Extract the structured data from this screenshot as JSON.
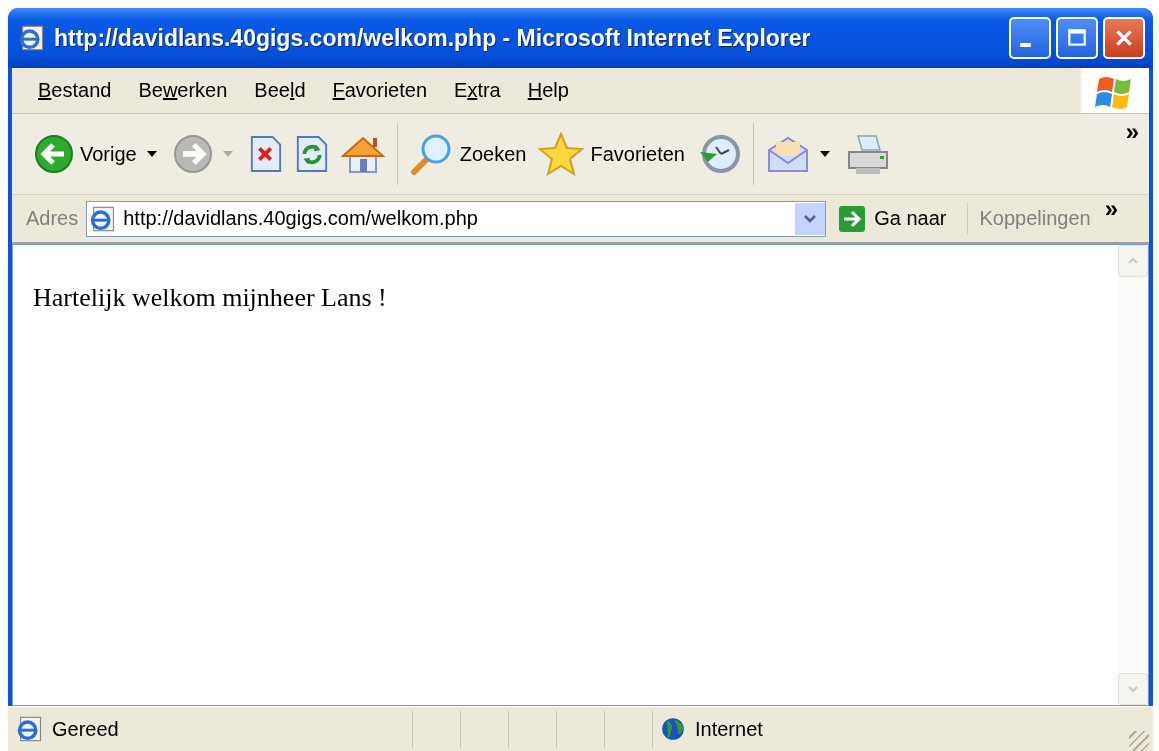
{
  "window": {
    "title": "http://davidlans.40gigs.com/welkom.php - Microsoft Internet Explorer"
  },
  "menu": [
    {
      "access_key": "B",
      "after": "estand"
    },
    {
      "before": "Be",
      "access_key": "w",
      "after": "erken"
    },
    {
      "before": "Bee",
      "access_key": "l",
      "after": "d"
    },
    {
      "access_key": "F",
      "after": "avorieten"
    },
    {
      "before": "E",
      "access_key": "x",
      "after": "tra"
    },
    {
      "access_key": "H",
      "after": "elp"
    }
  ],
  "toolbar_more": "»",
  "toolbar": [
    {
      "kind": "back",
      "label": "Vorige",
      "disabled": false,
      "dropdown": true
    },
    {
      "kind": "forward",
      "disabled": true,
      "dropdown": true
    },
    {
      "kind": "stop",
      "disabled": false
    },
    {
      "kind": "refresh",
      "disabled": false
    },
    {
      "kind": "home",
      "disabled": false
    },
    {
      "kind": "separator"
    },
    {
      "kind": "search",
      "label": "Zoeken",
      "disabled": false
    },
    {
      "kind": "favorites",
      "label": "Favorieten",
      "disabled": false
    },
    {
      "kind": "history",
      "disabled": false
    },
    {
      "kind": "separator"
    },
    {
      "kind": "mail",
      "disabled": false,
      "dropdown": true
    },
    {
      "kind": "print",
      "disabled": false
    }
  ],
  "address_bar": {
    "label": "Adres",
    "value": "http://davidlans.40gigs.com/welkom.php",
    "go": "Ga naar",
    "links": "Koppelingen",
    "more": "»"
  },
  "page": {
    "text": "Hartelijk welkom mijnheer Lans !"
  },
  "status_bar": {
    "text": "Gereed",
    "zone": "Internet"
  }
}
